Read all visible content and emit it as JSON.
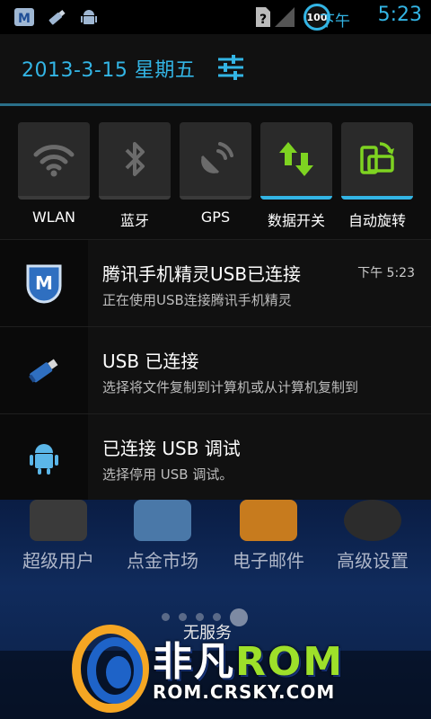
{
  "status_bar": {
    "icons": [
      "tencent-manager-icon",
      "usb-icon",
      "android-debug-icon"
    ],
    "battery_level": "100",
    "ampm": "下午",
    "time": "5:23"
  },
  "header": {
    "date": "2013-3-15 星期五",
    "settings_icon": "settings-sliders-icon"
  },
  "toggles": [
    {
      "label": "WLAN",
      "icon": "wifi-icon",
      "on": false
    },
    {
      "label": "蓝牙",
      "icon": "bluetooth-icon",
      "on": false
    },
    {
      "label": "GPS",
      "icon": "gps-icon",
      "on": false
    },
    {
      "label": "数据开关",
      "icon": "data-arrows-icon",
      "on": true
    },
    {
      "label": "自动旋转",
      "icon": "rotate-icon",
      "on": true
    }
  ],
  "notifications": [
    {
      "title": "腾讯手机精灵USB已连接",
      "text": "正在使用USB连接腾讯手机精灵",
      "time": "下午 5:23",
      "icon": "tencent-manager-icon"
    },
    {
      "title": "USB 已连接",
      "text": "选择将文件复制到计算机或从计算机复制到",
      "time": "",
      "icon": "usb-icon"
    },
    {
      "title": "已连接 USB 调试",
      "text": "选择停用 USB 调试。",
      "time": "",
      "icon": "android-debug-icon"
    }
  ],
  "home": {
    "apps": [
      "超级用户",
      "点金市场",
      "电子邮件",
      "高级设置"
    ],
    "carrier": "无服务"
  },
  "watermark": {
    "brand_cn": "非凡",
    "brand_rom": "ROM",
    "url": "ROM.CRSKY.COM"
  },
  "colors": {
    "accent": "#33b5e5",
    "active_icon": "#7ed321"
  }
}
